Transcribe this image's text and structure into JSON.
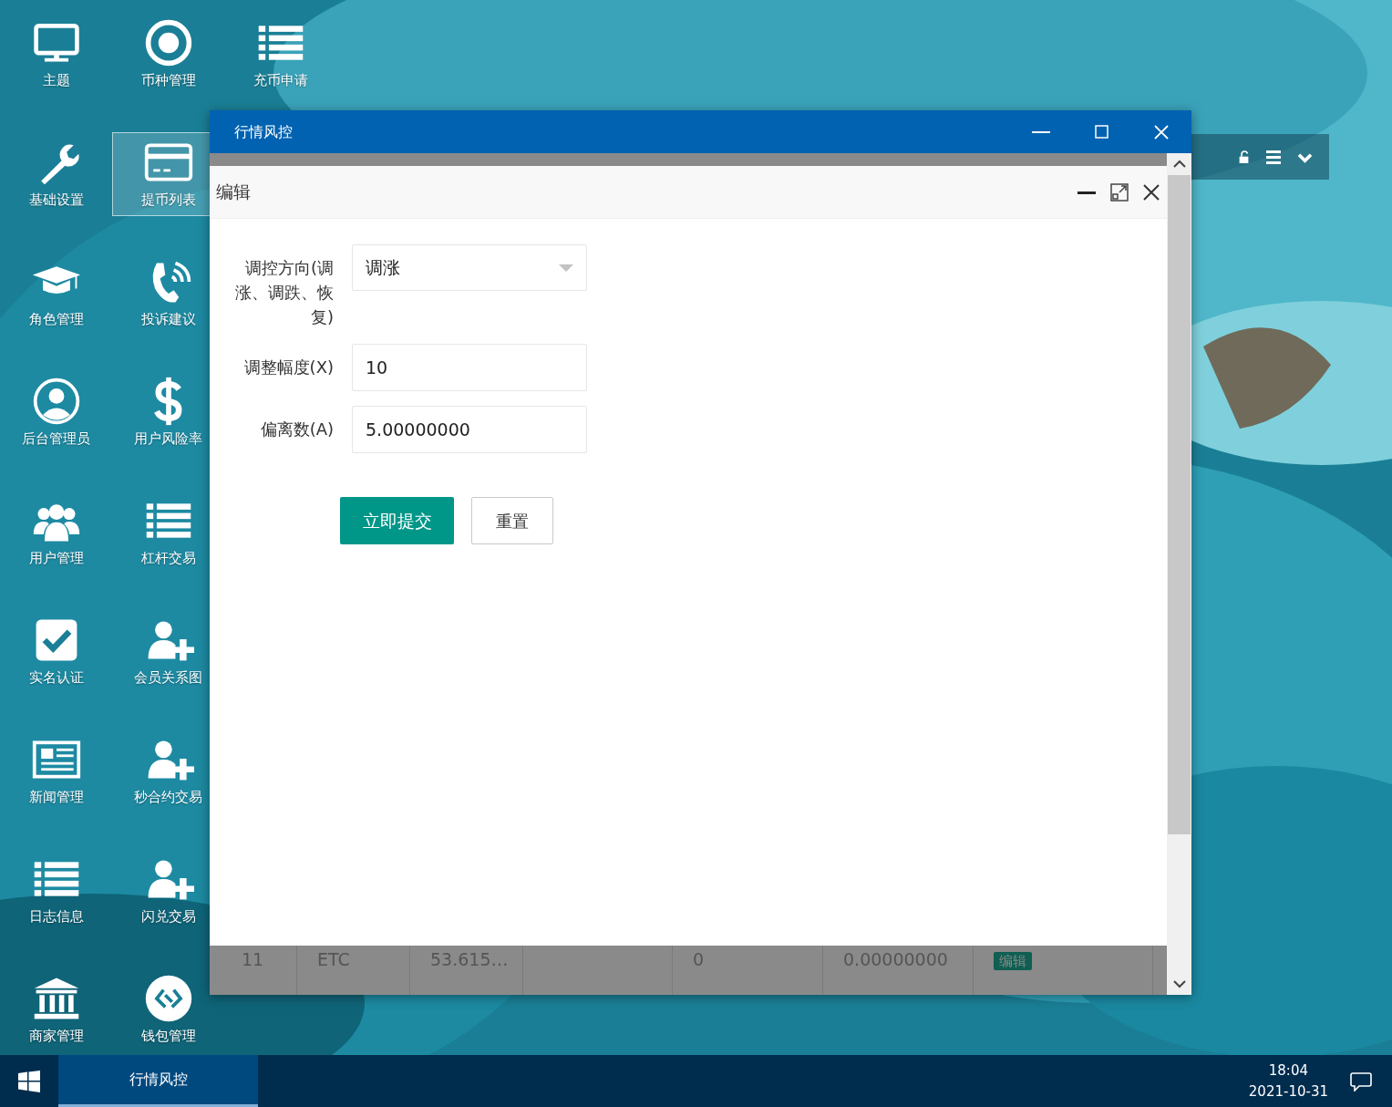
{
  "desktop_icons": [
    {
      "label": "主题",
      "selected": false
    },
    {
      "label": "基础设置",
      "selected": false
    },
    {
      "label": "角色管理",
      "selected": false
    },
    {
      "label": "后台管理员",
      "selected": false
    },
    {
      "label": "用户管理",
      "selected": false
    },
    {
      "label": "实名认证",
      "selected": false
    },
    {
      "label": "新闻管理",
      "selected": false
    },
    {
      "label": "日志信息",
      "selected": false
    },
    {
      "label": "商家管理",
      "selected": false
    },
    {
      "label": "币种管理",
      "selected": false
    },
    {
      "label": "提币列表",
      "selected": true
    },
    {
      "label": "投诉建议",
      "selected": false
    },
    {
      "label": "用户风险率",
      "selected": false
    },
    {
      "label": "杠杆交易",
      "selected": false
    },
    {
      "label": "会员关系图",
      "selected": false
    },
    {
      "label": "秒合约交易",
      "selected": false
    },
    {
      "label": "闪兑交易",
      "selected": false
    },
    {
      "label": "钱包管理",
      "selected": false
    },
    {
      "label": "充币申请",
      "selected": false
    }
  ],
  "window": {
    "title": "行情风控"
  },
  "background_table": {
    "rows": [
      {
        "cells": [
          "11",
          "ETC",
          "53.615…",
          "0",
          "0.00000000"
        ],
        "action": "编辑"
      }
    ]
  },
  "dialog": {
    "title": "编辑",
    "fields": [
      {
        "kind": "select",
        "label": "调控方向(调涨、调跌、恢复)",
        "value": "调涨"
      },
      {
        "kind": "text",
        "label": "调整幅度(X)",
        "value": "10"
      },
      {
        "kind": "text",
        "label": "偏离数(A)",
        "value": "5.00000000"
      }
    ],
    "buttons": [
      {
        "label": "立即提交",
        "kind": "primary"
      },
      {
        "label": "重置",
        "kind": "default"
      }
    ]
  },
  "taskbar": {
    "tasks": [
      {
        "label": "行情风控",
        "selected": true
      }
    ],
    "time": "18:04",
    "date": "2021-10-31"
  }
}
